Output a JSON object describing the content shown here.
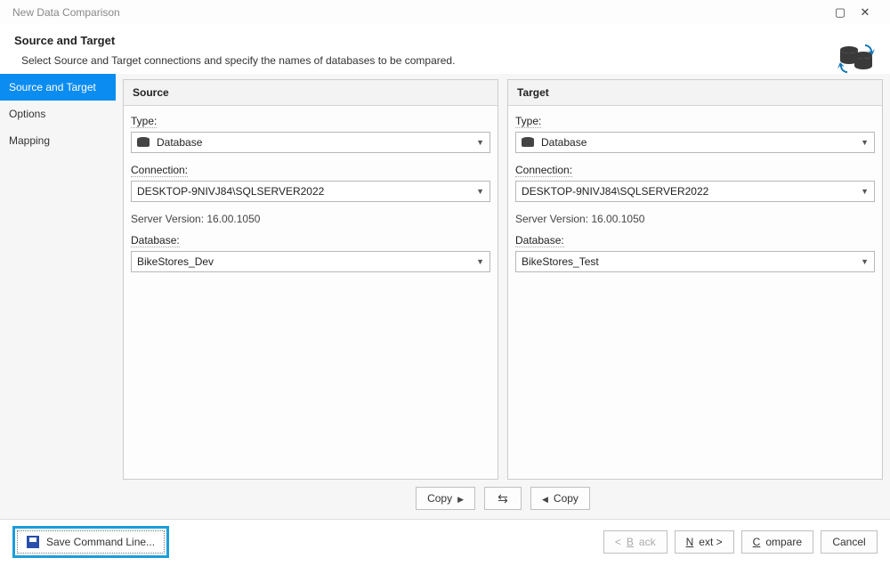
{
  "window": {
    "title": "New Data Comparison"
  },
  "header": {
    "title": "Source and Target",
    "description": "Select Source and Target connections and specify the names of databases to be compared."
  },
  "sidebar": {
    "items": [
      {
        "label": "Source and Target",
        "active": true
      },
      {
        "label": "Options",
        "active": false
      },
      {
        "label": "Mapping",
        "active": false
      }
    ]
  },
  "panels": {
    "source": {
      "title": "Source",
      "type_label": "Type:",
      "type_value": "Database",
      "connection_label": "Connection:",
      "connection_value": "DESKTOP-9NIVJ84\\SQLSERVER2022",
      "server_version_label": "Server Version: 16.00.1050",
      "database_label": "Database:",
      "database_value": "BikeStores_Dev"
    },
    "target": {
      "title": "Target",
      "type_label": "Type:",
      "type_value": "Database",
      "connection_label": "Connection:",
      "connection_value": "DESKTOP-9NIVJ84\\SQLSERVER2022",
      "server_version_label": "Server Version: 16.00.1050",
      "database_label": "Database:",
      "database_value": "BikeStores_Test"
    }
  },
  "copy_row": {
    "copy_right_label": "Copy",
    "copy_left_label": "Copy"
  },
  "footer": {
    "save_command_line": "Save Command Line...",
    "back": "Back",
    "next": "Next",
    "compare": "Compare",
    "cancel": "Cancel"
  }
}
